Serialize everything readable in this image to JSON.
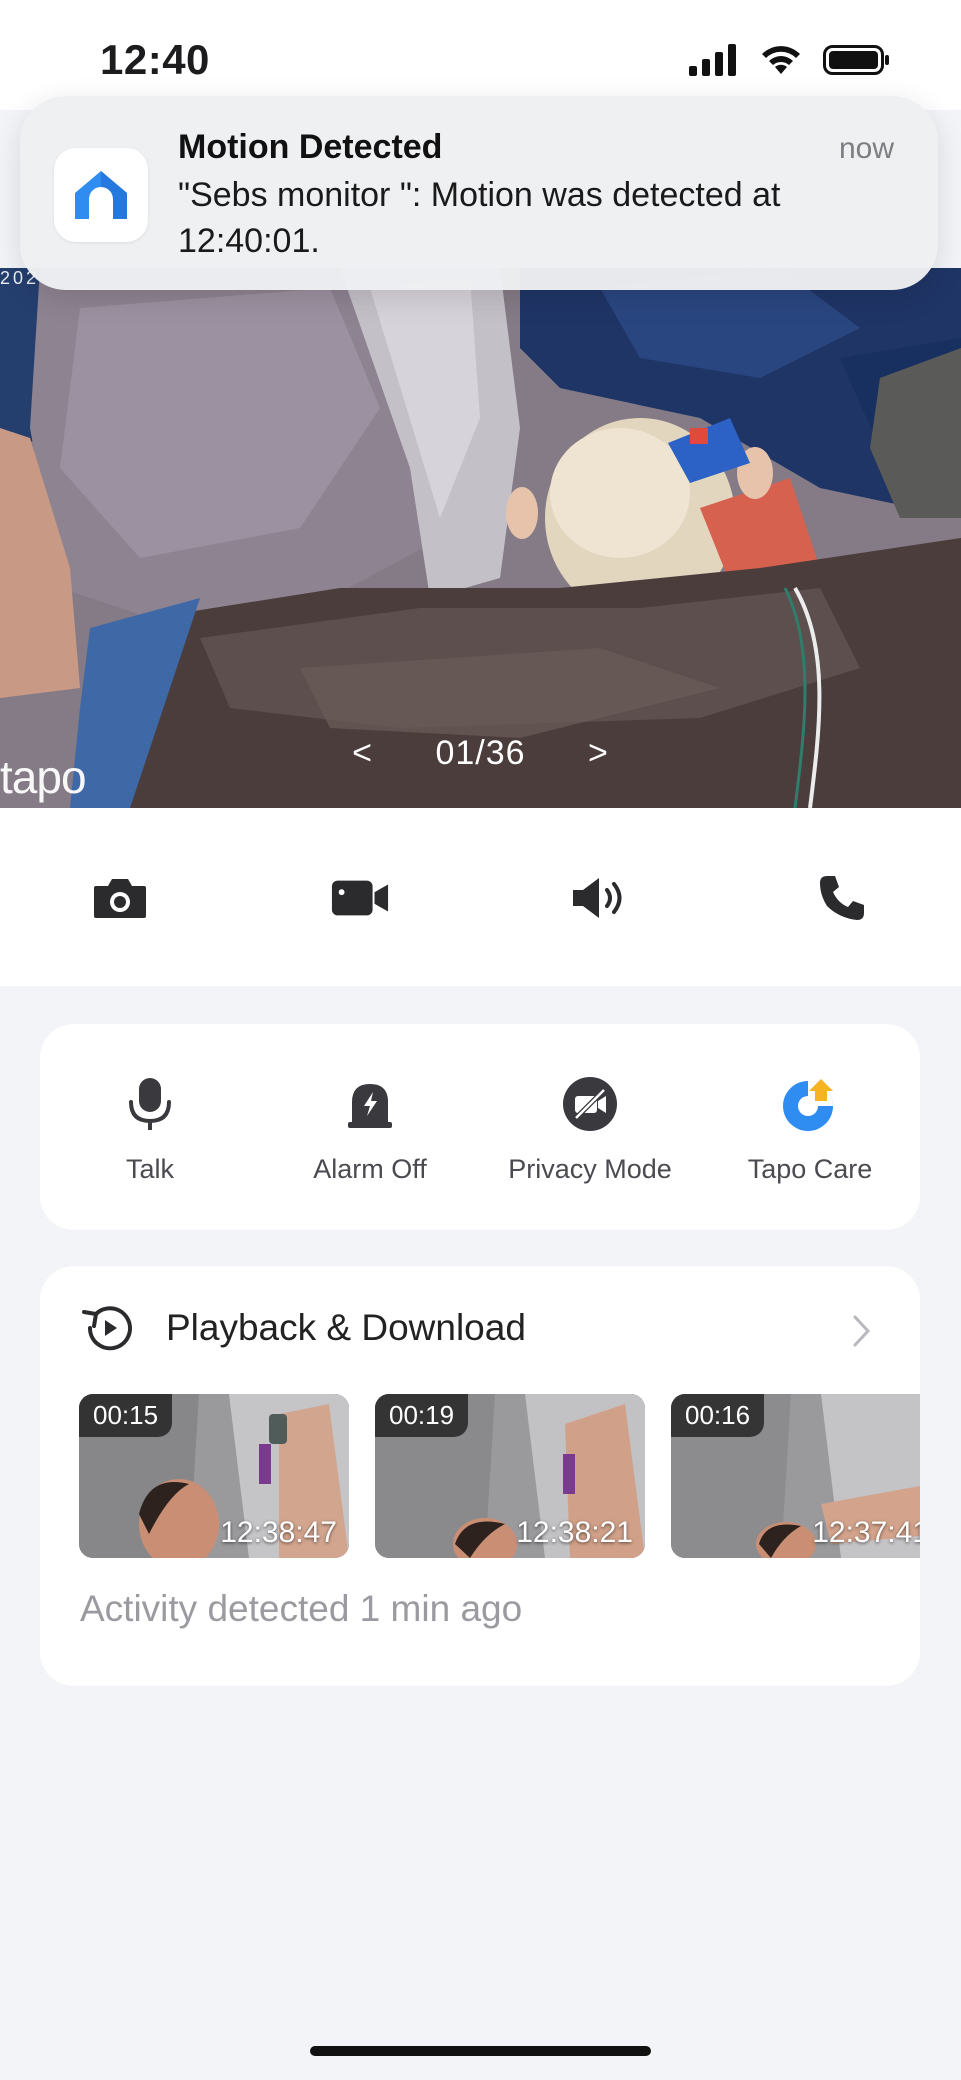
{
  "status_bar": {
    "time": "12:40"
  },
  "notification": {
    "title": "Motion Detected",
    "time": "now",
    "body": "\"Sebs monitor \": Motion was detected at 12:40:01."
  },
  "camera": {
    "pager_prev": "<",
    "pager_text": "01/36",
    "pager_next": ">",
    "brand": "tapo",
    "stamp": "202"
  },
  "controls": [
    {
      "icon": "camera-icon"
    },
    {
      "icon": "video-record-icon"
    },
    {
      "icon": "speaker-icon"
    },
    {
      "icon": "phone-icon"
    }
  ],
  "quick_actions": [
    {
      "label": "Talk",
      "icon": "microphone-icon"
    },
    {
      "label": "Alarm Off",
      "icon": "alarm-icon"
    },
    {
      "label": "Privacy Mode",
      "icon": "privacy-mode-icon"
    },
    {
      "label": "Tapo Care",
      "icon": "tapo-care-icon"
    }
  ],
  "playback": {
    "title": "Playback & Download",
    "clips": [
      {
        "duration": "00:15",
        "time": "12:38:47"
      },
      {
        "duration": "00:19",
        "time": "12:38:21"
      },
      {
        "duration": "00:16",
        "time": "12:37:41"
      }
    ],
    "activity": "Activity detected 1 min ago"
  },
  "colors": {
    "accent_blue": "#2f8cf0",
    "tapo_care_orange": "#f6b322",
    "background": "#f3f4f8"
  }
}
